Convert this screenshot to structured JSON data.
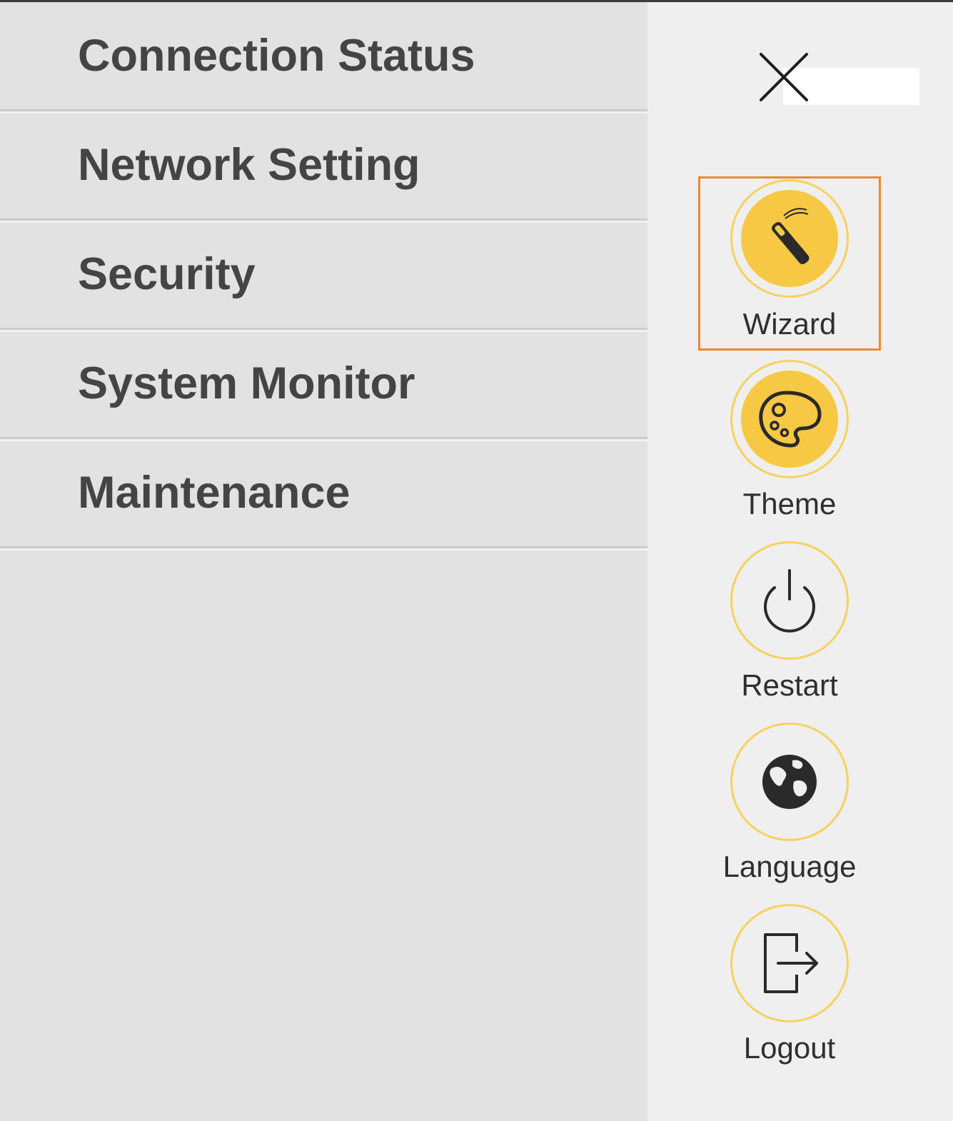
{
  "menu": {
    "items": [
      {
        "label": "Connection Status"
      },
      {
        "label": "Network Setting"
      },
      {
        "label": "Security"
      },
      {
        "label": "System Monitor"
      },
      {
        "label": "Maintenance"
      }
    ]
  },
  "actions": {
    "items": [
      {
        "label": "Wizard",
        "icon": "magic-wand-icon",
        "selected": true
      },
      {
        "label": "Theme",
        "icon": "palette-icon"
      },
      {
        "label": "Restart",
        "icon": "power-icon"
      },
      {
        "label": "Language",
        "icon": "globe-icon"
      },
      {
        "label": "Logout",
        "icon": "logout-icon"
      }
    ]
  },
  "colors": {
    "accent": "#f7c843",
    "ring": "#f7d15c",
    "highlight": "#f0882d",
    "menu_bg": "#e2e2e2",
    "text": "#444444"
  }
}
